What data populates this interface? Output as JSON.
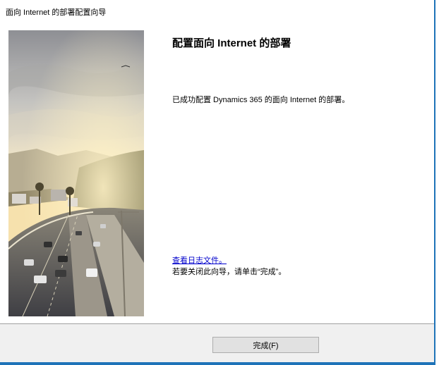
{
  "window": {
    "title": "面向 Internet 的部署配置向导"
  },
  "content": {
    "heading": "配置面向 Internet 的部署",
    "message": "已成功配置 Dynamics 365 的面向 Internet 的部署。",
    "log_link": "查看日志文件。",
    "close_hint": "若要关闭此向导，请单击“完成”。"
  },
  "footer": {
    "finish_label": "完成(F)"
  },
  "colors": {
    "window_border": "#1e73b8",
    "footer_bg": "#f0f0f0",
    "link": "#0000cc"
  }
}
